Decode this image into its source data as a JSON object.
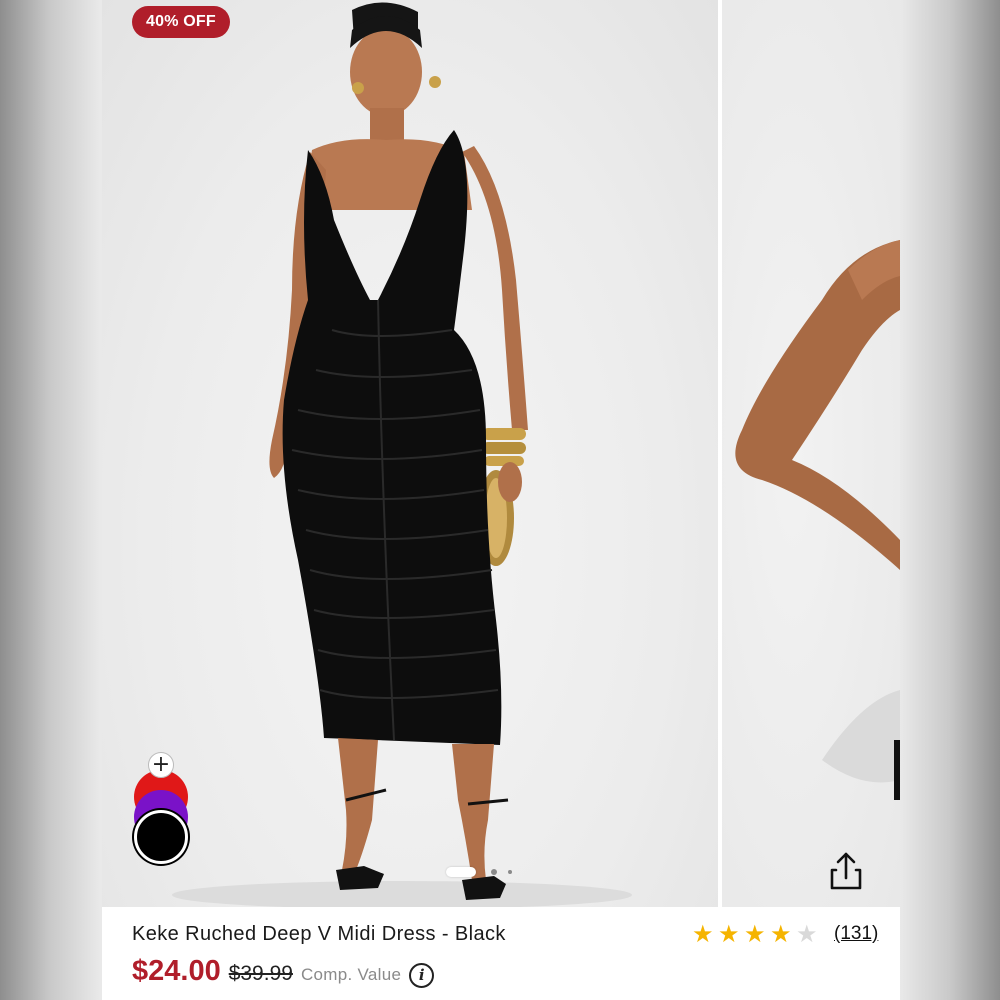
{
  "badge": {
    "discount": "40% OFF"
  },
  "product": {
    "title": "Keke Ruched Deep V Midi Dress - Black",
    "price_current": "$24.00",
    "price_original": "$39.99",
    "comp_value_label": "Comp. Value"
  },
  "rating": {
    "stars": 4,
    "max": 5,
    "review_count": "(131)"
  },
  "swatches": {
    "add_symbol": "+",
    "colors": [
      "#e01818",
      "#7a12c8",
      "#000000"
    ],
    "selected": "black"
  },
  "carousel": {
    "total_images": 3,
    "active_index": 0
  },
  "icons": {
    "share": "share-icon",
    "info": "info-icon",
    "star": "star-icon"
  },
  "colors": {
    "sale_red": "#b01e2a",
    "star_gold": "#f5b400"
  }
}
